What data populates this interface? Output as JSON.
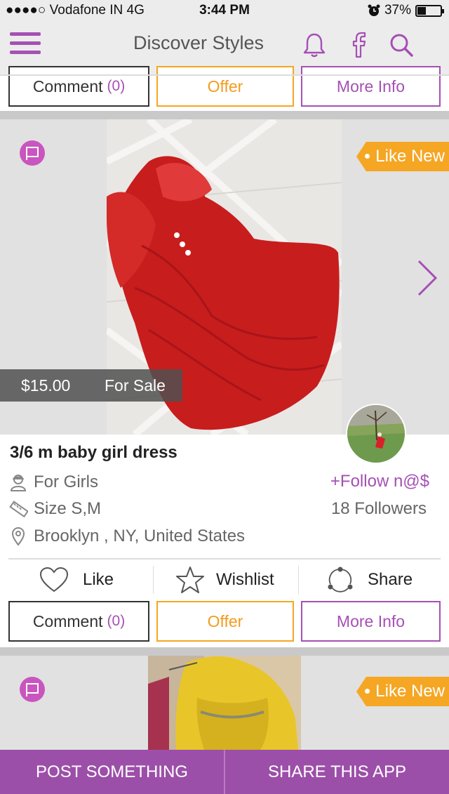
{
  "status_bar": {
    "carrier": "●●●●○ Vodafone IN  4G",
    "time": "3:44 PM",
    "battery": "37%",
    "battery_level": 0.37
  },
  "nav": {
    "title": "Discover Styles"
  },
  "top_buttons": {
    "comment": "Comment",
    "comment_count": "(0)",
    "offer": "Offer",
    "more_info": "More Info"
  },
  "listing": {
    "badge": "Like New",
    "price": "$15.00",
    "sale_status": "For Sale",
    "title": "3/6 m baby girl dress",
    "category": "For Girls",
    "size": "Size S,M",
    "location": "Brooklyn , NY, United States",
    "follow": "+Follow n@$",
    "followers": "18 Followers",
    "actions": {
      "like": "Like",
      "wishlist": "Wishlist",
      "share": "Share"
    },
    "buttons": {
      "comment": "Comment",
      "comment_count": "(0)",
      "offer": "Offer",
      "more_info": "More Info"
    }
  },
  "next_listing": {
    "badge": "Like New"
  },
  "bottom_bar": {
    "post": "POST SOMETHING",
    "share_app": "SHARE THIS APP"
  },
  "colors": {
    "accent": "#a550b4",
    "orange": "#f5a623",
    "bar": "#9c4fa8"
  }
}
